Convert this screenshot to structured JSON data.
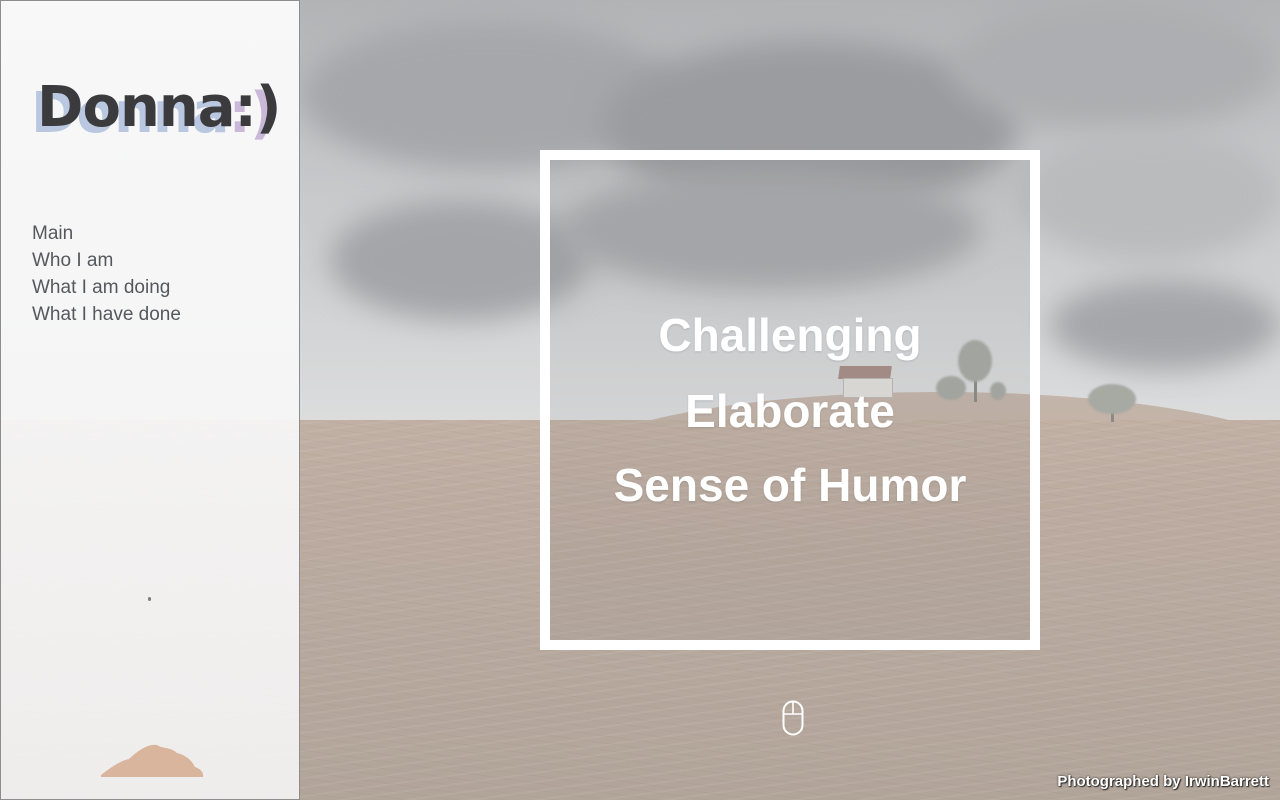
{
  "logo": {
    "name": "Donna",
    "smile": ":)"
  },
  "nav": {
    "items": [
      {
        "label": "Main"
      },
      {
        "label": "Who I am"
      },
      {
        "label": "What I am doing"
      },
      {
        "label": "What I have done"
      }
    ]
  },
  "hero": {
    "lines": [
      "Challenging",
      "Elaborate",
      "Sense of Humor"
    ]
  },
  "scroll_hint": {
    "icon": "mouse-icon"
  },
  "credit": {
    "text": "Photographed by IrwinBarrett"
  },
  "colors": {
    "sidebar_bg": "#f7f7f7",
    "nav_text": "#55585c",
    "logo_text": "#3b3b3e",
    "logo_shadow": "#b9c8e0",
    "frame": "#ffffff",
    "mound": "#d9b59d"
  }
}
